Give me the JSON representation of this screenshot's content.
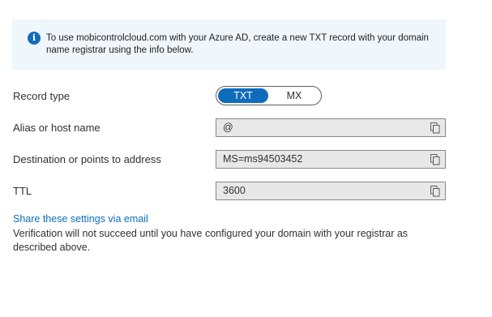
{
  "info_banner": {
    "icon": "info-icon",
    "text": "To use mobicontrolcloud.com with your Azure AD, create a new TXT record with your domain name registrar using the info below."
  },
  "record_type": {
    "label": "Record type",
    "options": [
      "TXT",
      "MX"
    ],
    "selected": "TXT"
  },
  "fields": [
    {
      "label": "Alias or host name",
      "value": "@"
    },
    {
      "label": "Destination or points to address",
      "value": "MS=ms94503452"
    },
    {
      "label": "TTL",
      "value": "3600"
    }
  ],
  "copy_icon": "copy-icon",
  "share_link": "Share these settings via email",
  "verification_note": "Verification will not succeed until you have configured your domain with your registrar as described above.",
  "colors": {
    "accent": "#0f6cbd",
    "banner_bg": "#eff6fc",
    "field_bg": "#e8e8e8"
  }
}
